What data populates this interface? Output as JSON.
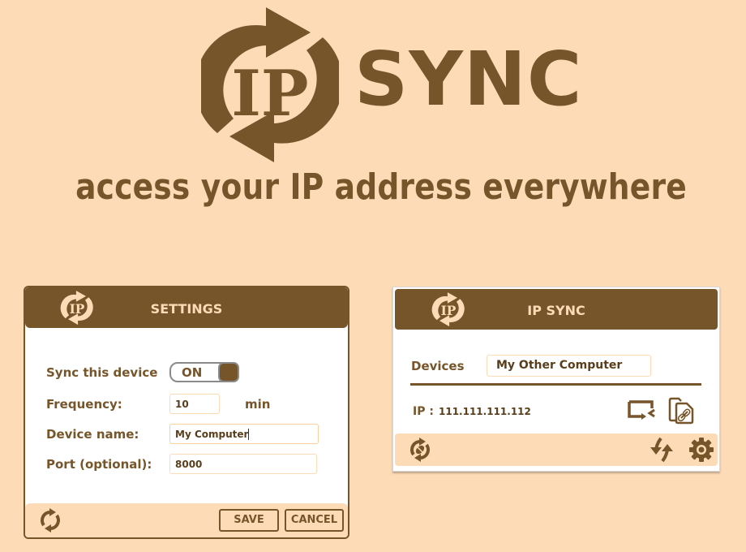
{
  "hero": {
    "logo_text": "IP",
    "title": "SYNC",
    "tagline": "access your IP address everywhere"
  },
  "colors": {
    "background": "#fedbb7",
    "brand_brown": "#76552a",
    "window_bg": "#ffffff",
    "toggle_border": "#8a8a8a"
  },
  "settings_window": {
    "logo_text": "IP",
    "title": "SETTINGS",
    "sync_label": "Sync this device",
    "sync_toggle": "ON",
    "frequency_label": "Frequency:",
    "frequency_value": "10",
    "frequency_unit": "min",
    "device_name_label": "Device name:",
    "device_name_value": "My Computer",
    "port_label": "Port (optional):",
    "port_value": "8000",
    "footer": {
      "refresh_icon": "refresh-icon",
      "save_label": "SAVE",
      "cancel_label": "CANCEL"
    }
  },
  "ipsync_window": {
    "logo_text": "IP",
    "title": "IP SYNC",
    "devices_label": "Devices",
    "selected_device": "My Other Computer",
    "ip_label": "IP :",
    "ip_value": "111.111.111.112",
    "actions": [
      "remote-desktop-icon",
      "copy-link-icon"
    ],
    "footer": [
      "sync-disconnected-icon",
      "sync-arrows-icon",
      "gear-icon"
    ]
  }
}
